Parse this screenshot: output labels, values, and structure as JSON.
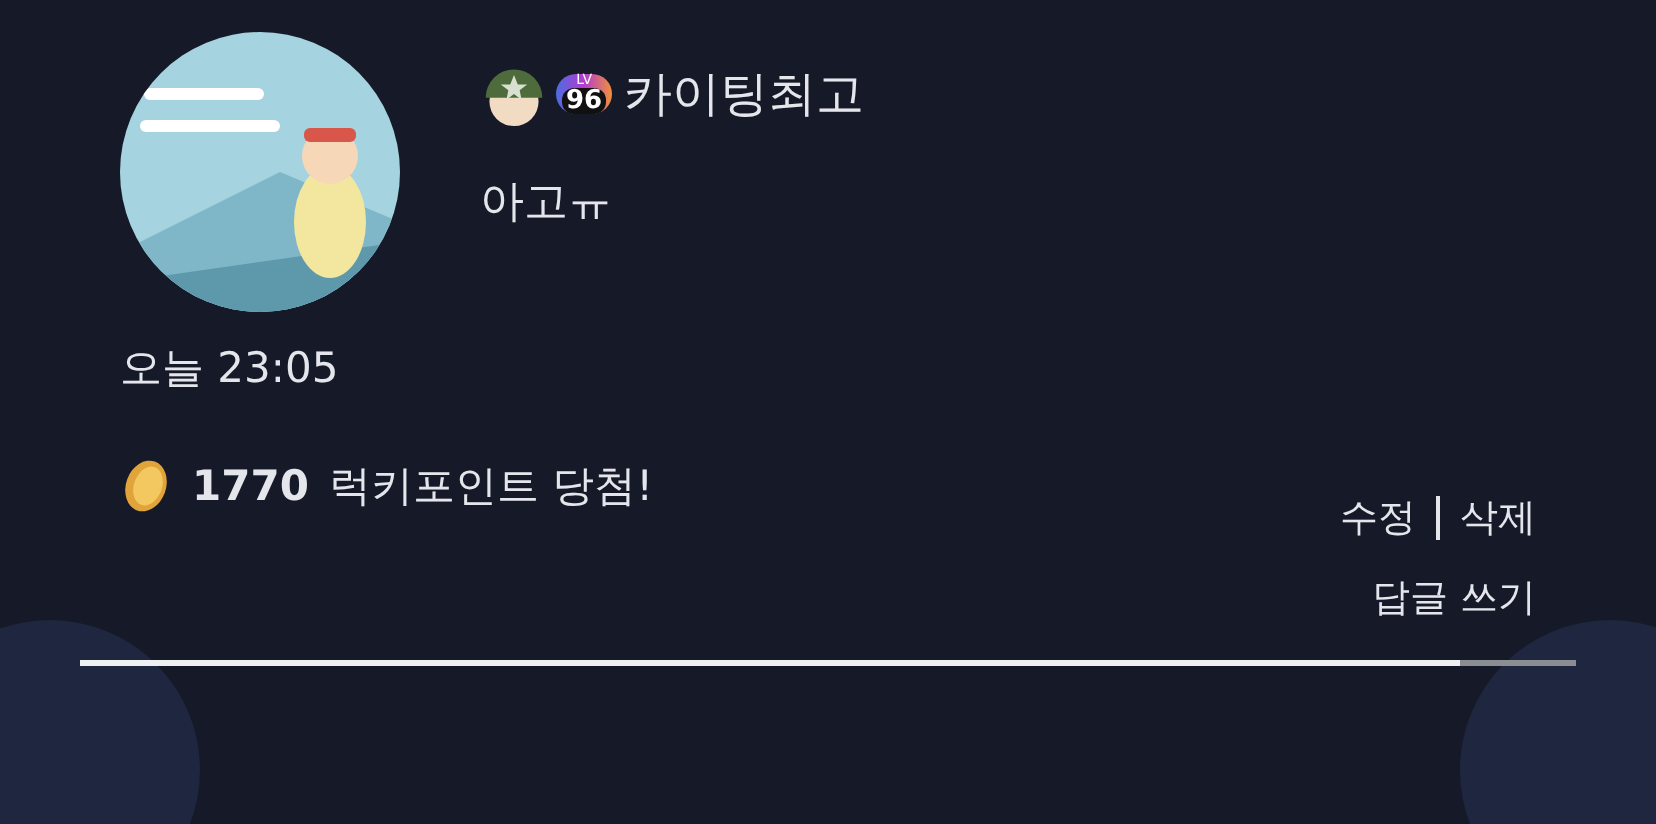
{
  "comment": {
    "level_badge": {
      "prefix": "LV",
      "level_text": "96"
    },
    "author": "카이팅최고",
    "text": "아고ㅠ",
    "time": "오늘 23:05",
    "reward": {
      "points": "1770",
      "message": "럭키포인트 당첨!"
    },
    "actions": [
      "수정",
      "삭제"
    ],
    "reply": "답글 쓰기"
  }
}
